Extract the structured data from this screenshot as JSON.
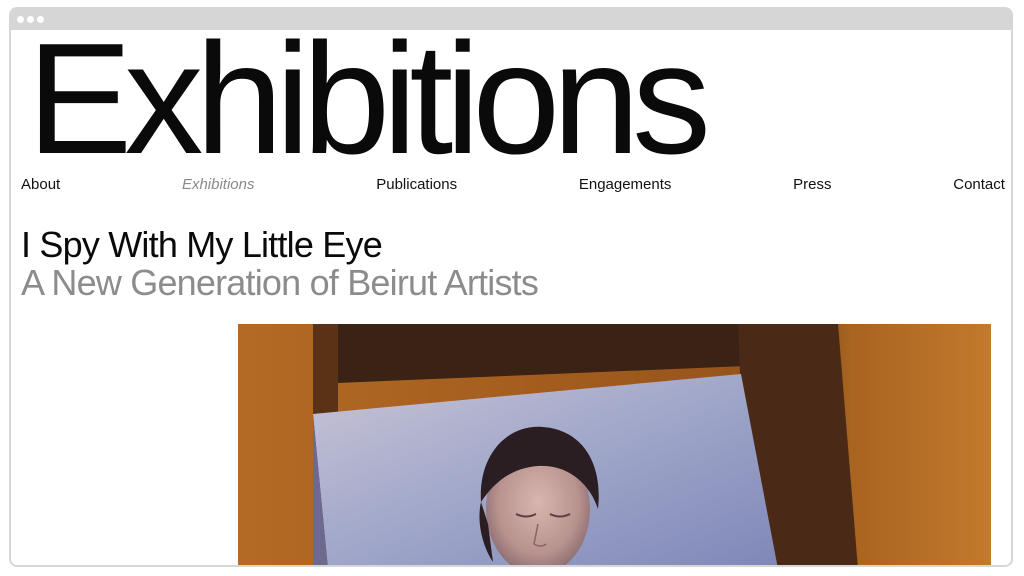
{
  "window": {
    "controls": [
      "dot",
      "dot",
      "dot"
    ]
  },
  "hero": {
    "title": "Exhibitions"
  },
  "nav": {
    "items": [
      {
        "label": "About",
        "active": false
      },
      {
        "label": "Exhibitions",
        "active": true
      },
      {
        "label": "Publications",
        "active": false
      },
      {
        "label": "Engagements",
        "active": false
      },
      {
        "label": "Press",
        "active": false
      },
      {
        "label": "Contact",
        "active": false
      }
    ]
  },
  "exhibition": {
    "title": "I Spy With My Little Eye",
    "subtitle": "A New Generation of Beirut Artists"
  },
  "feature_image": {
    "alt_icon": "photo-projection-portrait-icon"
  },
  "colors": {
    "text": "#0a0a0a",
    "muted": "#8c8c8c",
    "chrome": "#d6d6d6",
    "background": "#ffffff"
  }
}
